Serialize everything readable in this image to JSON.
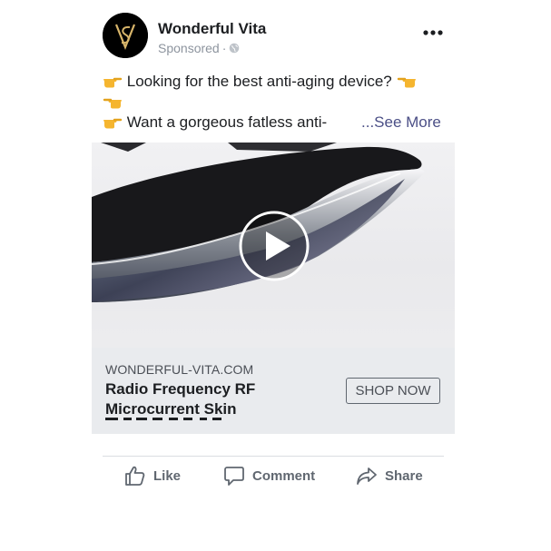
{
  "post": {
    "page_name": "Wonderful Vita",
    "meta_label": "Sponsored",
    "meta_separator": "·",
    "avatar_icon": "vs-monogram-logo",
    "text": {
      "line1": "Looking for the best anti-aging device?",
      "line3": "Want a gorgeous fatless anti-",
      "see_more": "...See More"
    }
  },
  "link_card": {
    "domain": "WONDERFUL-VITA.COM",
    "headline": "Radio Frequency RF Microcurrent Skin",
    "cta_label": "SHOP NOW"
  },
  "actions": {
    "like": "Like",
    "comment": "Comment",
    "share": "Share"
  },
  "colors": {
    "text": "#1c1e21",
    "secondary_text": "#8d949e",
    "see_more": "#4b4f86",
    "card_bg": "#e9ebee",
    "action_text": "#606770"
  }
}
